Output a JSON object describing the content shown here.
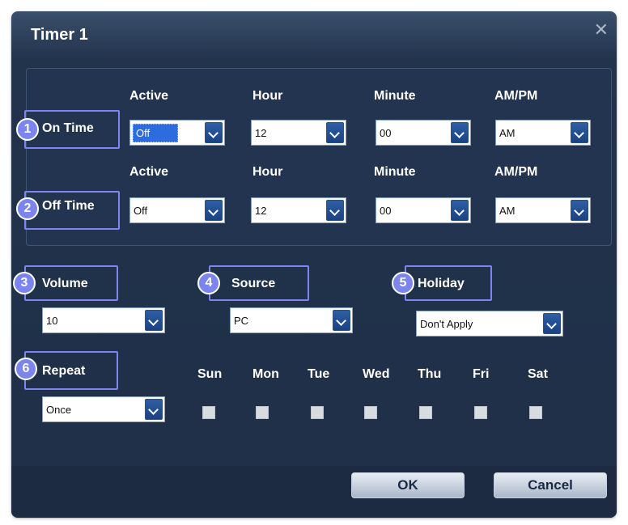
{
  "dialog": {
    "title": "Timer 1",
    "close_icon": "close-icon"
  },
  "columns": {
    "active": "Active",
    "hour": "Hour",
    "minute": "Minute",
    "ampm": "AM/PM"
  },
  "on_time": {
    "number": "1",
    "label": "On Time",
    "active": "Off",
    "hour": "12",
    "minute": "00",
    "ampm": "AM"
  },
  "off_time": {
    "number": "2",
    "label": "Off Time",
    "active": "Off",
    "hour": "12",
    "minute": "00",
    "ampm": "AM"
  },
  "volume": {
    "number": "3",
    "label": "Volume",
    "value": "10"
  },
  "source": {
    "number": "4",
    "label": "Source",
    "value": "PC"
  },
  "holiday": {
    "number": "5",
    "label": "Holiday",
    "value": "Don't Apply"
  },
  "repeat": {
    "number": "6",
    "label": "Repeat",
    "value": "Once"
  },
  "days": [
    "Sun",
    "Mon",
    "Tue",
    "Wed",
    "Thu",
    "Fri",
    "Sat"
  ],
  "buttons": {
    "ok": "OK",
    "cancel": "Cancel"
  },
  "colors": {
    "dialog_bg": "#22334c",
    "marker": "#7c85ee",
    "arrow": "#1b4283"
  }
}
